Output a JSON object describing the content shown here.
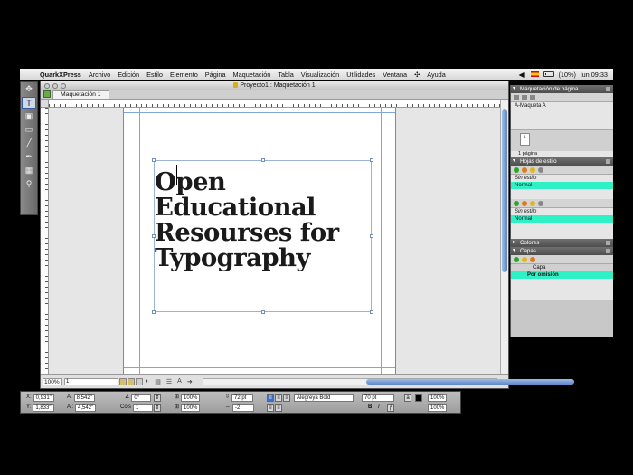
{
  "menubar": {
    "apple": "",
    "app_name": "QuarkXPress",
    "items": [
      "Archivo",
      "Edición",
      "Estilo",
      "Elemento",
      "Página",
      "Maquetación",
      "Tabla",
      "Visualización",
      "Utilidades",
      "Ventana",
      "Ayuda"
    ],
    "battery": "(10%)",
    "clock": "lun 09:33"
  },
  "document": {
    "window_title": "Proyecto1 : Maquetación 1",
    "tab_label": "Maquetación 1",
    "headline_lines": [
      "Open",
      "Educational",
      "Resourses for",
      "Typography"
    ],
    "zoom": "100%",
    "page_number": "1"
  },
  "palettes": {
    "page_layout": {
      "title": "Maquetación de página",
      "master": "A-Maqueta A",
      "thumb_label": "1",
      "page_count": "1 página"
    },
    "style_sheets": {
      "title": "Hojas de estilo",
      "para_styles": [
        "Sin estilo",
        "Normal"
      ],
      "char_styles": [
        "Sin estilo",
        "Normal"
      ]
    },
    "colors": {
      "title": "Colores"
    },
    "layers": {
      "title": "Capas",
      "column_header": "Capa",
      "layer_name": "Por omisión"
    }
  },
  "measurements": {
    "x_label": "X:",
    "x_value": "0,931\"",
    "y_label": "Y:",
    "y_value": "1,833\"",
    "w_label": "A:",
    "w_value": "8,542\"",
    "h_label": "Al:",
    "h_value": "4,542\"",
    "angle": "0°",
    "cols_label": "Cols",
    "cols_value": "1",
    "scale1": "100%",
    "scale2": "100%",
    "leading": "72 pt",
    "tracking": "-2",
    "font": "Alegreya Bold",
    "size": "70 pt",
    "shade1": "100%",
    "shade2": "100%",
    "style_b": "B",
    "style_i": "I"
  },
  "colors": {
    "selection": "#2ef2c6",
    "guide": "#7fa8d8",
    "scroll": "#5d86c9"
  }
}
